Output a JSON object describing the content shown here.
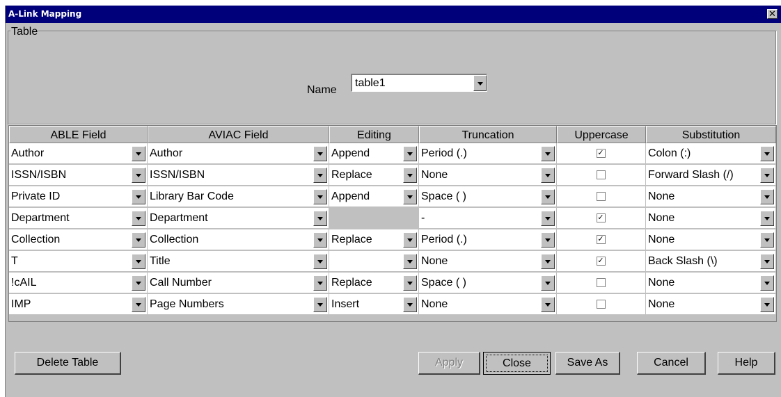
{
  "window": {
    "title": "A-Link Mapping",
    "close_glyph": "✕"
  },
  "table_group": {
    "legend": "Table",
    "name_label": "Name",
    "name_value": "table1"
  },
  "columns": [
    "ABLE Field",
    "AVIAC Field",
    "Editing",
    "Truncation",
    "Uppercase",
    "Substitution"
  ],
  "rows": [
    {
      "able": "Author",
      "aviac": "Author",
      "editing": "Append",
      "truncation": "Period (.)",
      "uppercase": true,
      "substitution": "Colon (:)"
    },
    {
      "able": "ISSN/ISBN",
      "aviac": "ISSN/ISBN",
      "editing": "Replace",
      "truncation": "None",
      "uppercase": false,
      "substitution": "Forward Slash (/)"
    },
    {
      "able": "Private ID",
      "aviac": "Library Bar Code",
      "editing": "Append",
      "truncation": "Space ( )",
      "uppercase": false,
      "substitution": "None"
    },
    {
      "able": "Department",
      "aviac": "Department",
      "editing": null,
      "truncation": "-",
      "uppercase": true,
      "substitution": "None"
    },
    {
      "able": "Collection",
      "aviac": "Collection",
      "editing": "Replace",
      "truncation": "Period (.)",
      "uppercase": true,
      "substitution": "None"
    },
    {
      "able": "T",
      "aviac": "Title",
      "editing": "",
      "truncation": "None",
      "uppercase": true,
      "substitution": "Back Slash (\\)"
    },
    {
      "able": "!cAIL",
      "aviac": "Call Number",
      "editing": "Replace",
      "truncation": "Space ( )",
      "uppercase": false,
      "substitution": "None"
    },
    {
      "able": "IMP",
      "aviac": "Page Numbers",
      "editing": "Insert",
      "truncation": "None",
      "uppercase": false,
      "substitution": "None"
    }
  ],
  "buttons": {
    "delete_table": "Delete Table",
    "apply": "Apply",
    "close": "Close",
    "save_as": "Save As",
    "cancel": "Cancel",
    "help": "Help"
  },
  "icons": {
    "dropdown": "chevron-down-icon",
    "checkmark": "✓"
  }
}
